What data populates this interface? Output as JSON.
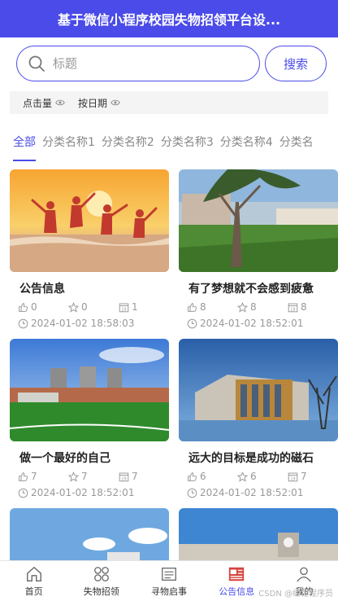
{
  "header": {
    "title": "基于微信小程序校园失物招领平台设..."
  },
  "search": {
    "placeholder": "标题",
    "button_label": "搜索"
  },
  "sort": {
    "items": [
      {
        "label": "点击量",
        "icon": "eye-icon"
      },
      {
        "label": "按日期",
        "icon": "eye-icon"
      }
    ]
  },
  "tabs": [
    "全部",
    "分类名称1",
    "分类名称2",
    "分类名称3",
    "分类名称4",
    "分类名"
  ],
  "active_tab": 0,
  "cards": [
    {
      "title": "公告信息",
      "likes": "0",
      "favorites": "0",
      "views": "1",
      "time": "2024-01-02 18:58:03",
      "image": "beach-jump-photo"
    },
    {
      "title": "有了梦想就不会感到疲惫",
      "likes": "8",
      "favorites": "8",
      "views": "8",
      "time": "2024-01-02 18:52:01",
      "image": "campus-tree-photo"
    },
    {
      "title": "做一个最好的自己",
      "likes": "7",
      "favorites": "7",
      "views": "7",
      "time": "2024-01-02 18:52:01",
      "image": "campus-field-photo"
    },
    {
      "title": "远大的目标是成功的磁石",
      "likes": "6",
      "favorites": "6",
      "views": "7",
      "time": "2024-01-02 18:52:01",
      "image": "modern-building-photo"
    },
    {
      "image": "sky-building-photo"
    },
    {
      "image": "clock-tower-photo"
    }
  ],
  "bottom_nav": [
    {
      "label": "首页",
      "icon": "home-icon"
    },
    {
      "label": "失物招领",
      "icon": "grid-icon"
    },
    {
      "label": "寻物启事",
      "icon": "notice-icon"
    },
    {
      "label": "公告信息",
      "icon": "newspaper-icon"
    },
    {
      "label": "我的",
      "icon": "user-icon"
    }
  ],
  "active_nav": 3,
  "watermark": "CSDN @编程程序员",
  "colors": {
    "primary": "#4a4be8",
    "muted": "#999999"
  }
}
